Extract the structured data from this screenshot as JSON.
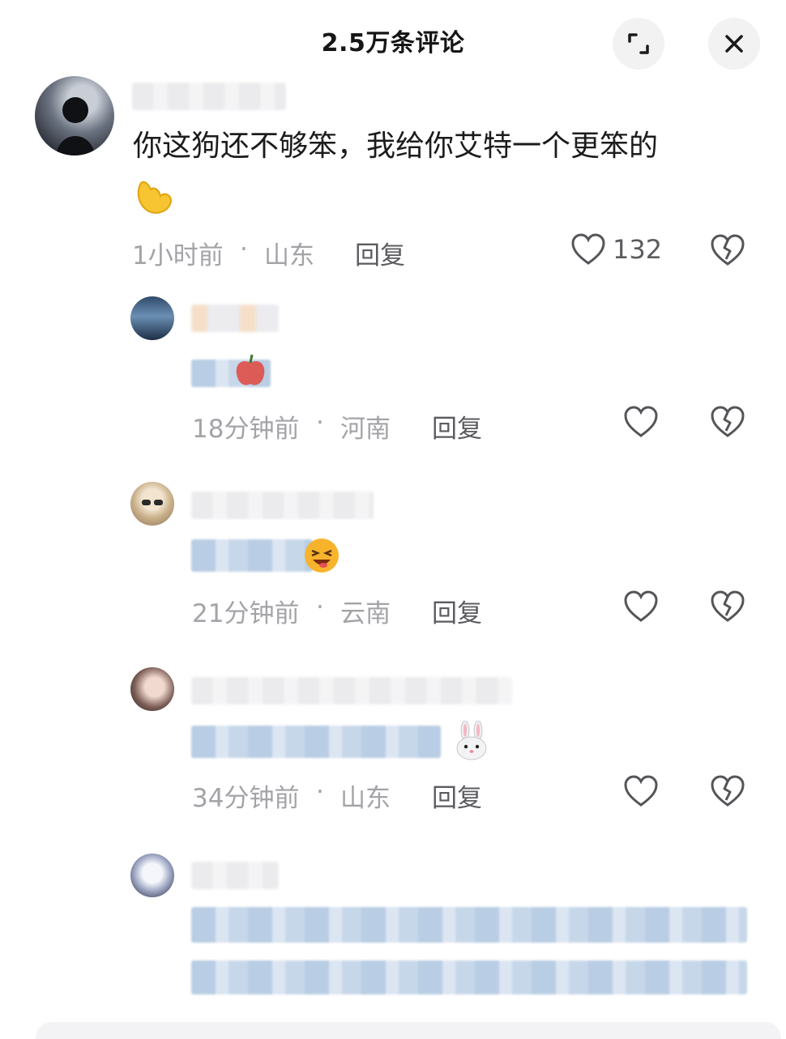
{
  "header": {
    "title": "2.5万条评论",
    "expand_icon": "expand-icon",
    "close_icon": "close-icon"
  },
  "main_comment": {
    "text": "你这狗还不够笨，我给你艾特一个更笨的",
    "emoji": "muscle-emoji",
    "time": "1小时前",
    "location": "山东",
    "reply_label": "回复",
    "like_count": "132"
  },
  "replies": [
    {
      "time": "18分钟前",
      "location": "河南",
      "reply_label": "回复",
      "emoji": "apple-emoji"
    },
    {
      "time": "21分钟前",
      "location": "云南",
      "reply_label": "回复",
      "emoji": "laughing-emoji"
    },
    {
      "time": "34分钟前",
      "location": "山东",
      "reply_label": "回复",
      "emoji": "rabbit-emoji"
    },
    {
      "time": "",
      "location": "",
      "reply_label": "",
      "emoji": ""
    }
  ],
  "separator": "·",
  "colors": {
    "accent_blue_blur": "#b9cde4",
    "meta_gray": "#a3a3a8",
    "icon_bg": "#f2f2f3"
  }
}
